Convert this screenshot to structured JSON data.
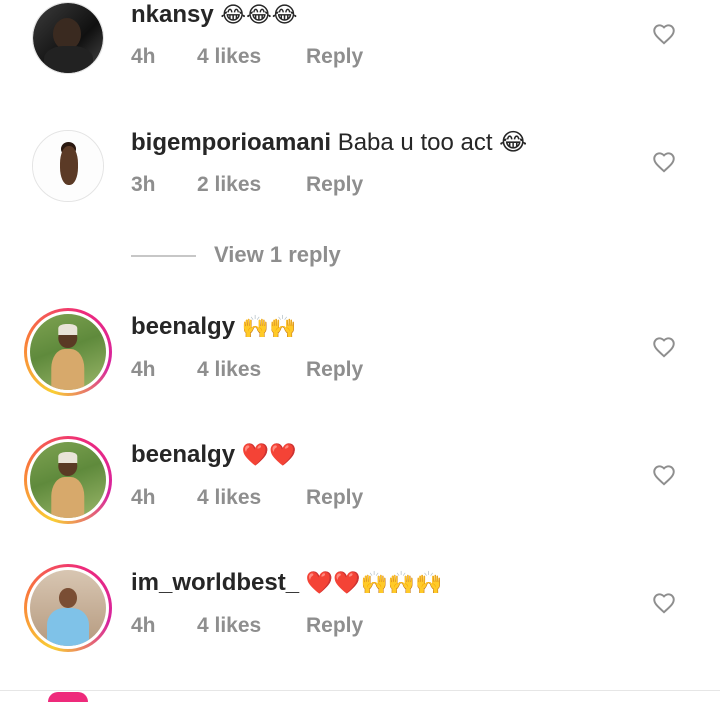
{
  "comments": [
    {
      "username": "nkansy",
      "text": "😂😂😂",
      "time": "4h",
      "likes": "4 likes",
      "reply": "Reply",
      "avatar": "dark-portrait-avatar"
    },
    {
      "username": "bigemporioamani",
      "text": "Baba u too act 😂",
      "time": "3h",
      "likes": "2 likes",
      "reply": "Reply",
      "avatar": "baby-avatar"
    },
    {
      "username": "beenalgy",
      "text": "🙌🙌",
      "time": "4h",
      "likes": "4 likes",
      "reply": "Reply",
      "avatar": "green-story-avatar"
    },
    {
      "username": "beenalgy",
      "text": "❤️❤️",
      "time": "4h",
      "likes": "4 likes",
      "reply": "Reply",
      "avatar": "green-story-avatar"
    },
    {
      "username": "im_worldbest_",
      "text": "❤️❤️🙌🙌🙌",
      "time": "4h",
      "likes": "4 likes",
      "reply": "Reply",
      "avatar": "room-story-avatar"
    }
  ],
  "view_replies": {
    "label": "View 1 reply"
  },
  "icons": {
    "like": "heart-outline-icon"
  },
  "colors": {
    "muted": "#8e8e8e",
    "text": "#262626",
    "story_ring": "#ee2a7b"
  }
}
